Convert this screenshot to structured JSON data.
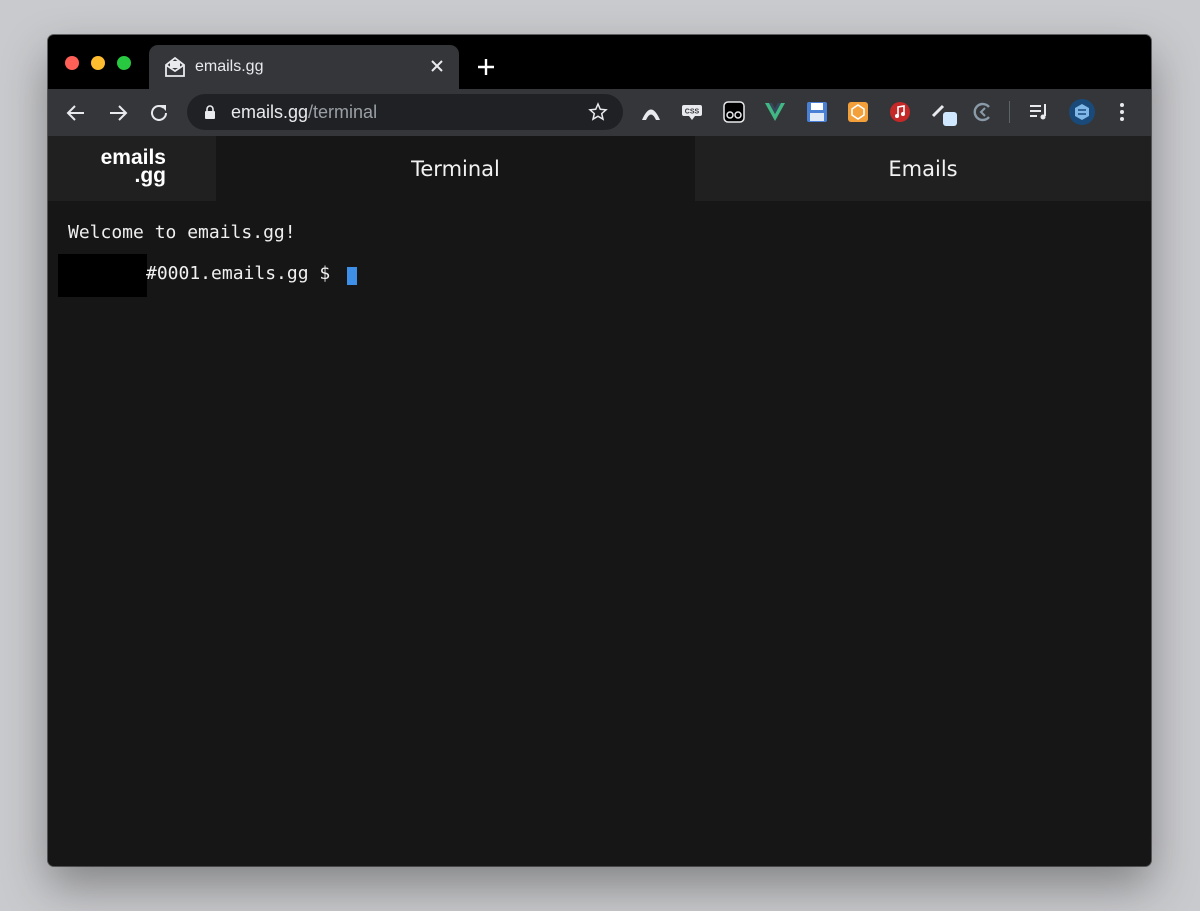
{
  "browser": {
    "tab": {
      "title": "emails.gg",
      "favicon": "envelope-open-icon"
    },
    "omnibox": {
      "host": "emails.gg",
      "path": "/terminal"
    },
    "extensions": [
      "mountain-icon",
      "css-icon",
      "glasses-icon",
      "vue-icon",
      "floppy-disk-icon",
      "orange-extension-icon",
      "music-icon",
      "pen-icon",
      "refresh-ring-icon",
      "playlist-icon",
      "avatar-icon"
    ]
  },
  "app": {
    "logo": {
      "line1": "emails",
      "line2": ".gg"
    },
    "nav": {
      "terminal": "Terminal",
      "emails": "Emails"
    },
    "terminal": {
      "welcome": "Welcome to emails.gg!",
      "prompt": "#0001.emails.gg $ "
    }
  },
  "colors": {
    "cursor": "#3d8fe8",
    "background": "#161616"
  }
}
